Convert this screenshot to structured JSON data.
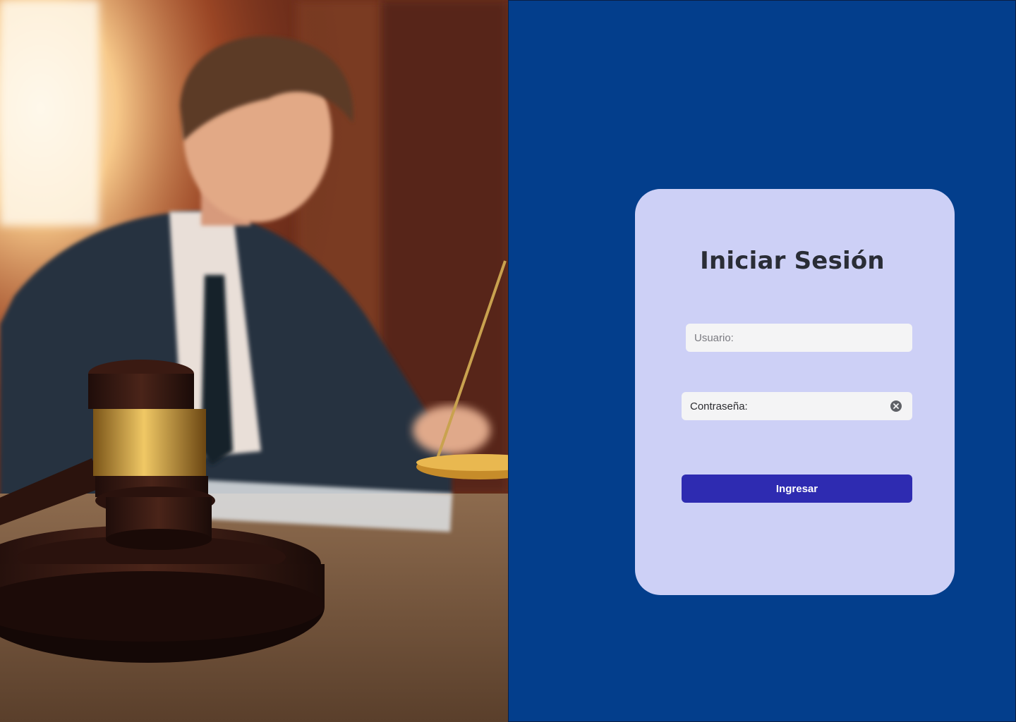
{
  "hero": {
    "image_description_icon": "lawyer-gavel-photo"
  },
  "login": {
    "title": "Iniciar Sesión",
    "username_placeholder": "Usuario:",
    "username_value": "",
    "password_label": "Contraseña:",
    "password_value": "",
    "submit_label": "Ingresar"
  },
  "colors": {
    "panel_bg": "#033e8c",
    "card_bg": "#cdd0f6",
    "button_bg": "#2e2bb1",
    "title_text": "#2a2d36"
  }
}
